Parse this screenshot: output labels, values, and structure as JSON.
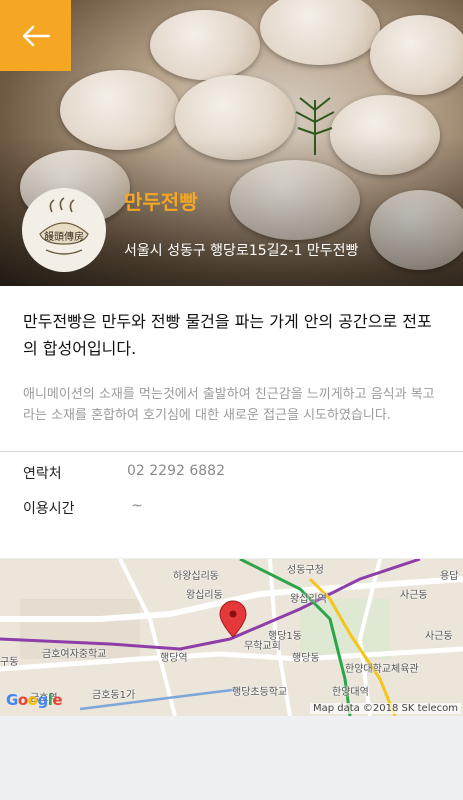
{
  "header": {
    "back_icon": "arrow-left-icon",
    "accent": "#f5a623"
  },
  "shop": {
    "name": "만두전빵",
    "address": "서울시 성동구 행당로15길2-1 만두전빵",
    "logo_text": "饅頭傳房"
  },
  "content": {
    "headline": "만두전빵은 만두와 전빵 물건을 파는 가게 안의 공간으로 전포의 합성어입니다.",
    "description": "애니메이션의 소재를 먹는것에서 출발하여 친근감을 느끼게하고 음식과 복고라는 소재를 혼합하여 호기심에 대한 새로운 접근을 시도하였습니다."
  },
  "info": {
    "contact_label": "연락처",
    "contact_value": "02 2292 6882",
    "hours_label": "이용시간",
    "hours_value": "~"
  },
  "map": {
    "labels": {
      "seongdong": "성동구청",
      "hayang": "하왕십리동",
      "wangsimni_dong": "왕십리동",
      "wangsimni_stn": "왕십리역",
      "yongdap": "용답",
      "sageun1": "사근동",
      "muhak": "무학교회",
      "haengdang1": "행당1동",
      "sageun2": "사근동",
      "gumho": "금호여자중학교",
      "haengdang_stn": "행당역",
      "haengdang_dong": "행당동",
      "hanyang_gym": "한양대학교체육관",
      "gudong": "구동",
      "gumho_1": "금호동1가",
      "haengdang_elem": "행당초등학교",
      "hanyang_stn": "한양대역",
      "geumho": "금호역"
    },
    "google": "Google",
    "attribution": "Map data ©2018 SK telecom"
  }
}
